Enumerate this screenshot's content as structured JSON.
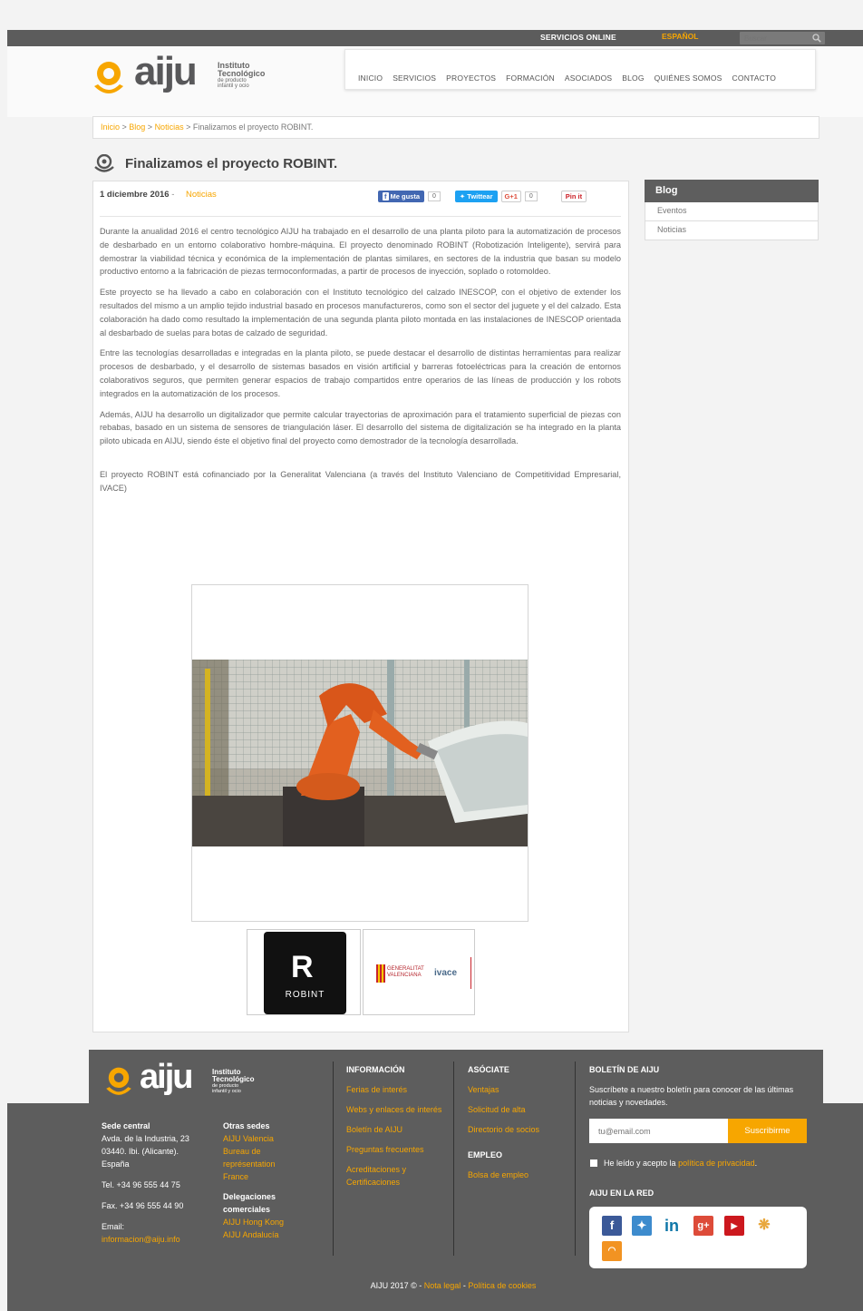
{
  "topbar": {
    "services": "SERVICIOS ONLINE",
    "language": "ESPAÑOL",
    "search_placeholder": "Buscar"
  },
  "brand": {
    "name": "aiju",
    "sub1": "Instituto",
    "sub2": "Tecnológico",
    "sub3": "de producto",
    "sub4": "infantil y ocio",
    "accent": "#f7a600"
  },
  "nav": [
    "INICIO",
    "SERVICIOS",
    "PROYECTOS",
    "FORMACIÓN",
    "ASOCIADOS",
    "BLOG",
    "QUIÉNES SOMOS",
    "CONTACTO"
  ],
  "breadcrumb": {
    "home": "Inicio",
    "sep1": " > ",
    "blog": "Blog",
    "sep2": " > ",
    "news": "Noticias",
    "sep3": " > ",
    "current": "Finalizamos el proyecto ROBINT."
  },
  "article": {
    "title": "Finalizamos el proyecto ROBINT.",
    "date": "1 diciembre 2016",
    "date_sep": " - ",
    "category": "Noticias",
    "share": {
      "facebook": "Me gusta",
      "facebook_count": "0",
      "twitter": "Twittear",
      "gplus": "G+1",
      "gplus_count": "0",
      "pinterest": "Pin it"
    },
    "paragraphs": [
      "Durante la anualidad 2016 el centro tecnológico AIJU ha trabajado en el desarrollo de una planta piloto para la automatización de procesos de desbarbado en un entorno colaborativo hombre-máquina. El proyecto denominado ROBINT (Robotización Inteligente), servirá para demostrar la viabilidad técnica y económica de la implementación de plantas similares, en sectores de la industria que basan su modelo productivo entorno a la fabricación de piezas termoconformadas, a partir de procesos de inyección, soplado o rotomoldeo.",
      "Este proyecto se ha llevado a cabo en colaboración con el Instituto tecnológico del calzado INESCOP, con el objetivo de extender los resultados del mismo a un amplio tejido industrial basado en procesos manufactureros, como son el sector del juguete y el del calzado. Esta colaboración ha dado como resultado la implementación de una segunda planta piloto montada en las instalaciones de INESCOP orientada al desbarbado de suelas para botas de calzado de seguridad.",
      "Entre las tecnologías desarrolladas e integradas en la planta piloto, se puede destacar el desarrollo de distintas herramientas para realizar procesos de desbarbado, y el desarrollo de sistemas basados en visión artificial y barreras fotoeléctricas para la creación de entornos colaborativos seguros, que permiten generar espacios de trabajo compartidos entre operarios de las líneas de producción y los robots integrados en la automatización de los procesos.",
      "Además, AIJU ha desarrollo un digitalizador que permite calcular trayectorias de aproximación para el tratamiento superficial de piezas con rebabas, basado en un sistema de sensores de triangulación láser. El desarrollo del sistema de digitalización se ha integrado en la planta piloto ubicada en AIJU, siendo éste el objetivo final del proyecto como demostrador de la tecnología desarrollada.",
      "El proyecto ROBINT está cofinanciado por la Generalitat Valenciana (a través del Instituto Valenciano de Competitividad Empresarial, IVACE)"
    ],
    "thumb1_label": "ROBINT",
    "thumb2_gva": "GENERALITAT VALENCIANA",
    "thumb2_ivace": "ivace"
  },
  "sidebar": {
    "title": "Blog",
    "items": [
      "Eventos",
      "Noticias"
    ]
  },
  "footer": {
    "hq_title": "Sede central",
    "hq_addr1": "Avda. de la Industria, 23",
    "hq_addr2": "03440. Ibi. (Alicante).",
    "hq_addr3": "España",
    "tel": "Tel. +34 96 555 44 75",
    "fax": "Fax. +34 96 555 44 90",
    "email_label": "Email:",
    "email": "informacion@aiju.info",
    "other_title": "Otras sedes",
    "other": [
      "AIJU Valencia",
      "Bureau de représentation France"
    ],
    "deleg_title": "Delegaciones comerciales",
    "deleg": [
      "AIJU Hong Kong",
      "AIJU Andalucía"
    ],
    "info_title": "INFORMACIÓN",
    "info": [
      "Ferias de interés",
      "Webs y enlaces de interés",
      "Boletín de AIJU",
      "Preguntas frecuentes",
      "Acreditaciones y Certificaciones"
    ],
    "join_title": "ASÓCIATE",
    "join": [
      "Ventajas",
      "Solicitud de alta",
      "Directorio de socios"
    ],
    "jobs_title": "EMPLEO",
    "jobs": [
      "Bolsa de empleo"
    ],
    "news_title": "BOLETÍN DE AIJU",
    "news_text": "Suscríbete a nuestro boletín para conocer de las últimas noticias y novedades.",
    "news_placeholder": "tu@email.com",
    "news_button": "Suscribirme",
    "privacy_pre": "He leído y acepto la ",
    "privacy_link": "política de privacidad",
    "privacy_post": ".",
    "social_title": "AIJU EN LA RED",
    "copyright": "AIJU 2017 © - ",
    "legal": "Nota legal",
    "dash": " - ",
    "cookies": "Política de cookies"
  }
}
